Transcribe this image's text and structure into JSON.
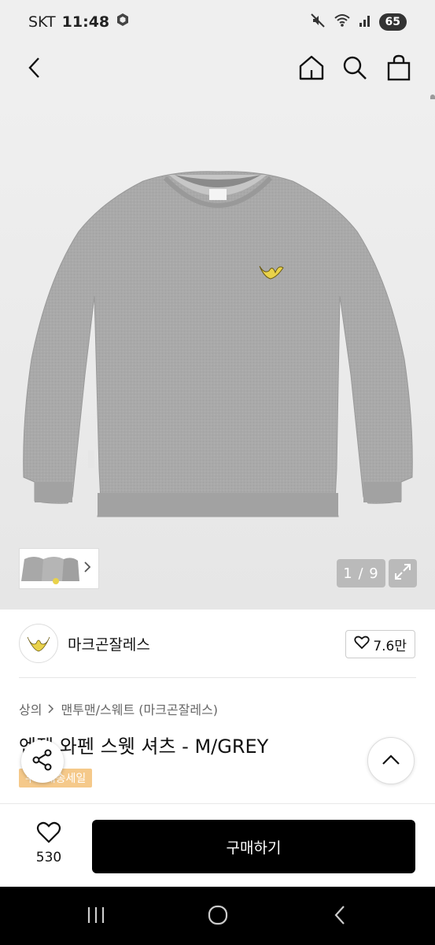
{
  "status_bar": {
    "carrier": "SKT",
    "time": "11:48",
    "battery": "65"
  },
  "hero": {
    "counter": "1 / 9"
  },
  "seller": {
    "name": "마크곤잘레스",
    "likes": "7.6만"
  },
  "breadcrumb": {
    "category": "상의",
    "subcategory": "맨투맨/스웨트 (마크곤잘레스)"
  },
  "product": {
    "title": "엔젤 와펜 스웻 셔츠 - M/GREY",
    "badge": "무료배송세일"
  },
  "action_bar": {
    "wish_count": "530",
    "buy_label": "구매하기"
  },
  "colors": {
    "accent": "#000000",
    "badge": "#f5c98a",
    "sweatshirt": "#a9a9a9"
  }
}
